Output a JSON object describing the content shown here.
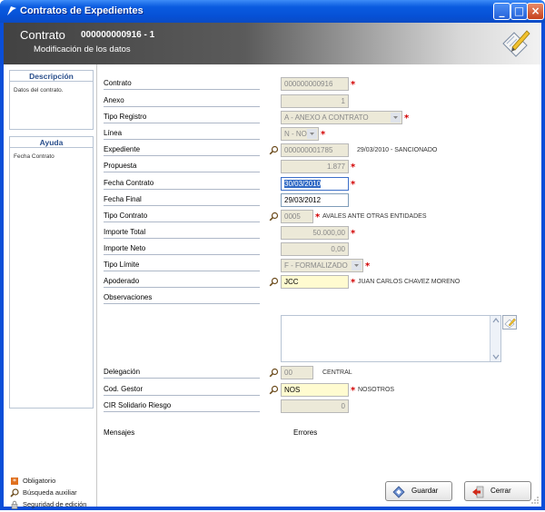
{
  "window": {
    "title": "Contratos de Expedientes",
    "minimize": "_",
    "maximize": "□",
    "close": "×"
  },
  "header": {
    "entity": "Contrato",
    "number": "000000000916 - 1",
    "subtitle": "Modificación de los datos"
  },
  "sidebar": {
    "descripcion": {
      "title": "Descripción",
      "text": "Datos del contrato."
    },
    "ayuda": {
      "title": "Ayuda",
      "text": "Fecha Contrato"
    },
    "legend": [
      {
        "icon": "required-icon",
        "label": "Obligatorio"
      },
      {
        "icon": "magnifier-icon",
        "label": "Búsqueda auxiliar"
      },
      {
        "icon": "lock-icon",
        "label": "Seguridad de edición"
      }
    ]
  },
  "form": {
    "contrato": {
      "label": "Contrato",
      "value": "000000000916"
    },
    "anexo": {
      "label": "Anexo",
      "value": "1"
    },
    "tipo_registro": {
      "label": "Tipo Registro",
      "value": "A - ANEXO A CONTRATO"
    },
    "linea": {
      "label": "Línea",
      "value": "N - NO"
    },
    "expediente": {
      "label": "Expediente",
      "value": "000000001785",
      "aux": "29/03/2010 - SANCIONADO"
    },
    "propuesta": {
      "label": "Propuesta",
      "value": "1.877"
    },
    "fecha_contrato": {
      "label": "Fecha Contrato",
      "value": "30/03/2010"
    },
    "fecha_final": {
      "label": "Fecha Final",
      "value": "29/03/2012"
    },
    "tipo_contrato": {
      "label": "Tipo Contrato",
      "value": "0005",
      "aux": "AVALES ANTE OTRAS ENTIDADES"
    },
    "importe_total": {
      "label": "Importe Total",
      "value": "50.000,00"
    },
    "importe_neto": {
      "label": "Importe Neto",
      "value": "0,00"
    },
    "tipo_limite": {
      "label": "Tipo Límite",
      "value": "F - FORMALIZADO"
    },
    "apoderado": {
      "label": "Apoderado",
      "value": "JCC",
      "aux": "JUAN CARLOS CHAVEZ MORENO"
    },
    "observaciones": {
      "label": "Observaciones",
      "value": ""
    },
    "delegacion": {
      "label": "Delegación",
      "value": "00",
      "aux": "CENTRAL"
    },
    "cod_gestor": {
      "label": "Cod. Gestor",
      "value": "NOS",
      "aux": "NOSOTROS"
    },
    "cir_solidario": {
      "label": "CIR Solidario Riesgo",
      "value": "0"
    },
    "mensajes": "Mensajes",
    "errores": "Errores"
  },
  "buttons": {
    "guardar": "Guardar",
    "cerrar": "Cerrar"
  },
  "colors": {
    "title_bar": "#0a5be0",
    "required": "#d20000",
    "readonly_field": "#ece9d8",
    "highlight_field": "#fffbd0",
    "selection": "#316ac5"
  }
}
